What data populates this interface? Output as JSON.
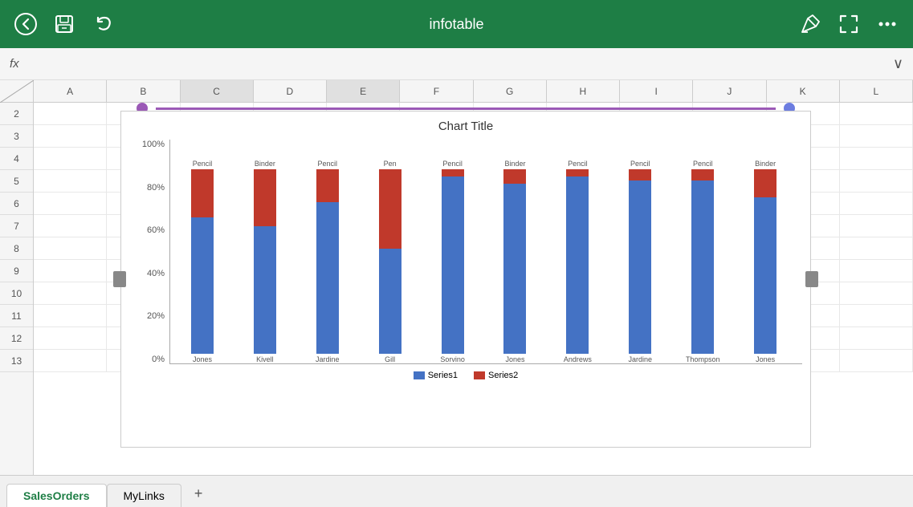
{
  "toolbar": {
    "title": "infotable",
    "back_icon": "←",
    "save_icon": "⊡",
    "undo_icon": "↩",
    "edit_icon": "✏",
    "fullscreen_icon": "⛶",
    "more_icon": "···"
  },
  "formula_bar": {
    "fx_label": "fx",
    "chevron_label": "∨"
  },
  "columns": [
    "A",
    "B",
    "C",
    "D",
    "E",
    "F",
    "G",
    "H",
    "I",
    "J",
    "K",
    "L"
  ],
  "rows": [
    "2",
    "3",
    "4",
    "5",
    "6",
    "7",
    "8",
    "9",
    "10",
    "11",
    "12",
    "13"
  ],
  "chart": {
    "title": "Chart Title",
    "y_axis_labels": [
      "100%",
      "80%",
      "60%",
      "40%",
      "20%",
      "0%"
    ],
    "bars": [
      {
        "label_top": "Pencil",
        "label_bot": "Jones",
        "s1_pct": 74,
        "s2_pct": 26
      },
      {
        "label_top": "Binder",
        "label_bot": "Kivell",
        "s1_pct": 69,
        "s2_pct": 31
      },
      {
        "label_top": "Pencil",
        "label_bot": "Jardine",
        "s1_pct": 82,
        "s2_pct": 18
      },
      {
        "label_top": "Pen",
        "label_bot": "Gill",
        "s1_pct": 57,
        "s2_pct": 43
      },
      {
        "label_top": "Pencil",
        "label_bot": "Sorvino",
        "s1_pct": 96,
        "s2_pct": 4
      },
      {
        "label_top": "Binder",
        "label_bot": "Jones",
        "s1_pct": 92,
        "s2_pct": 8
      },
      {
        "label_top": "Pencil",
        "label_bot": "Andrews",
        "s1_pct": 96,
        "s2_pct": 4
      },
      {
        "label_top": "Pencil",
        "label_bot": "Jardine",
        "s1_pct": 94,
        "s2_pct": 6
      },
      {
        "label_top": "Pencil",
        "label_bot": "Thompson",
        "s1_pct": 94,
        "s2_pct": 6
      },
      {
        "label_top": "Binder",
        "label_bot": "Jones",
        "s1_pct": 85,
        "s2_pct": 15
      }
    ],
    "legend": {
      "series1_label": "Series1",
      "series2_label": "Series2"
    }
  },
  "tabs": {
    "tab1_label": "SalesOrders",
    "tab2_label": "MyLinks",
    "add_label": "+"
  }
}
